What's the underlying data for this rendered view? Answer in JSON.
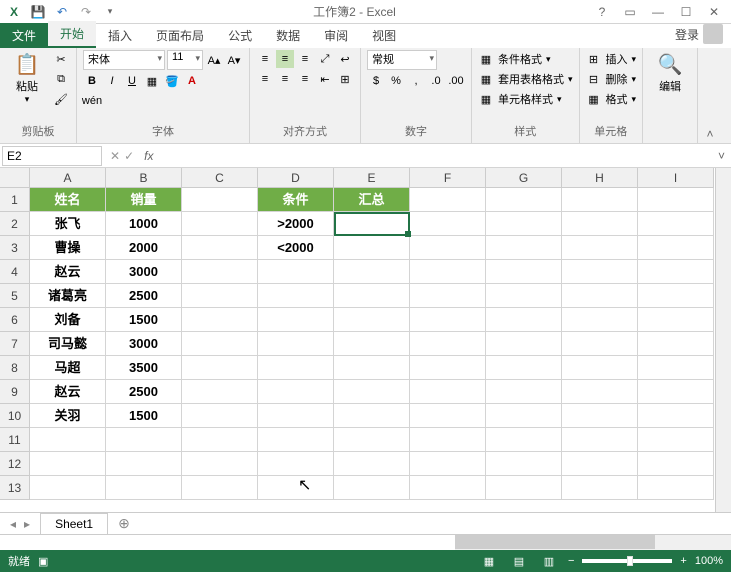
{
  "titlebar": {
    "title": "工作簿2 - Excel"
  },
  "tabs": {
    "file": "文件",
    "home": "开始",
    "insert": "插入",
    "layout": "页面布局",
    "formulas": "公式",
    "data": "数据",
    "review": "审阅",
    "view": "视图",
    "login": "登录"
  },
  "ribbon": {
    "clipboard": {
      "paste": "粘贴",
      "label": "剪贴板"
    },
    "font": {
      "name": "宋体",
      "size": "11",
      "label": "字体"
    },
    "align": {
      "label": "对齐方式"
    },
    "number": {
      "format": "常规",
      "label": "数字"
    },
    "styles": {
      "cond": "条件格式",
      "table": "套用表格格式",
      "cell": "单元格样式",
      "label": "样式"
    },
    "cells": {
      "insert": "插入",
      "delete": "删除",
      "format": "格式",
      "label": "单元格"
    },
    "editing": {
      "label": "编辑"
    }
  },
  "namebox": "E2",
  "columns": [
    "A",
    "B",
    "C",
    "D",
    "E",
    "F",
    "G",
    "H",
    "I"
  ],
  "rows": [
    "1",
    "2",
    "3",
    "4",
    "5",
    "6",
    "7",
    "8",
    "9",
    "10",
    "11",
    "12",
    "13"
  ],
  "cells": {
    "A1": "姓名",
    "B1": "销量",
    "D1": "条件",
    "E1": "汇总",
    "A2": "张飞",
    "B2": "1000",
    "D2": ">2000",
    "A3": "曹操",
    "B3": "2000",
    "D3": "<2000",
    "A4": "赵云",
    "B4": "3000",
    "A5": "诸葛亮",
    "B5": "2500",
    "A6": "刘备",
    "B6": "1500",
    "A7": "司马懿",
    "B7": "3000",
    "A8": "马超",
    "B8": "3500",
    "A9": "赵云",
    "B9": "2500",
    "A10": "关羽",
    "B10": "1500"
  },
  "sheet": {
    "tab1": "Sheet1"
  },
  "status": {
    "ready": "就绪",
    "zoom": "100%"
  },
  "chart_data": {
    "type": "table",
    "title": "销量",
    "columns": [
      "姓名",
      "销量"
    ],
    "rows": [
      [
        "张飞",
        1000
      ],
      [
        "曹操",
        2000
      ],
      [
        "赵云",
        3000
      ],
      [
        "诸葛亮",
        2500
      ],
      [
        "刘备",
        1500
      ],
      [
        "司马懿",
        3000
      ],
      [
        "马超",
        3500
      ],
      [
        "赵云",
        2500
      ],
      [
        "关羽",
        1500
      ]
    ],
    "criteria": {
      "条件": [
        ">2000",
        "<2000"
      ],
      "汇总": []
    }
  }
}
